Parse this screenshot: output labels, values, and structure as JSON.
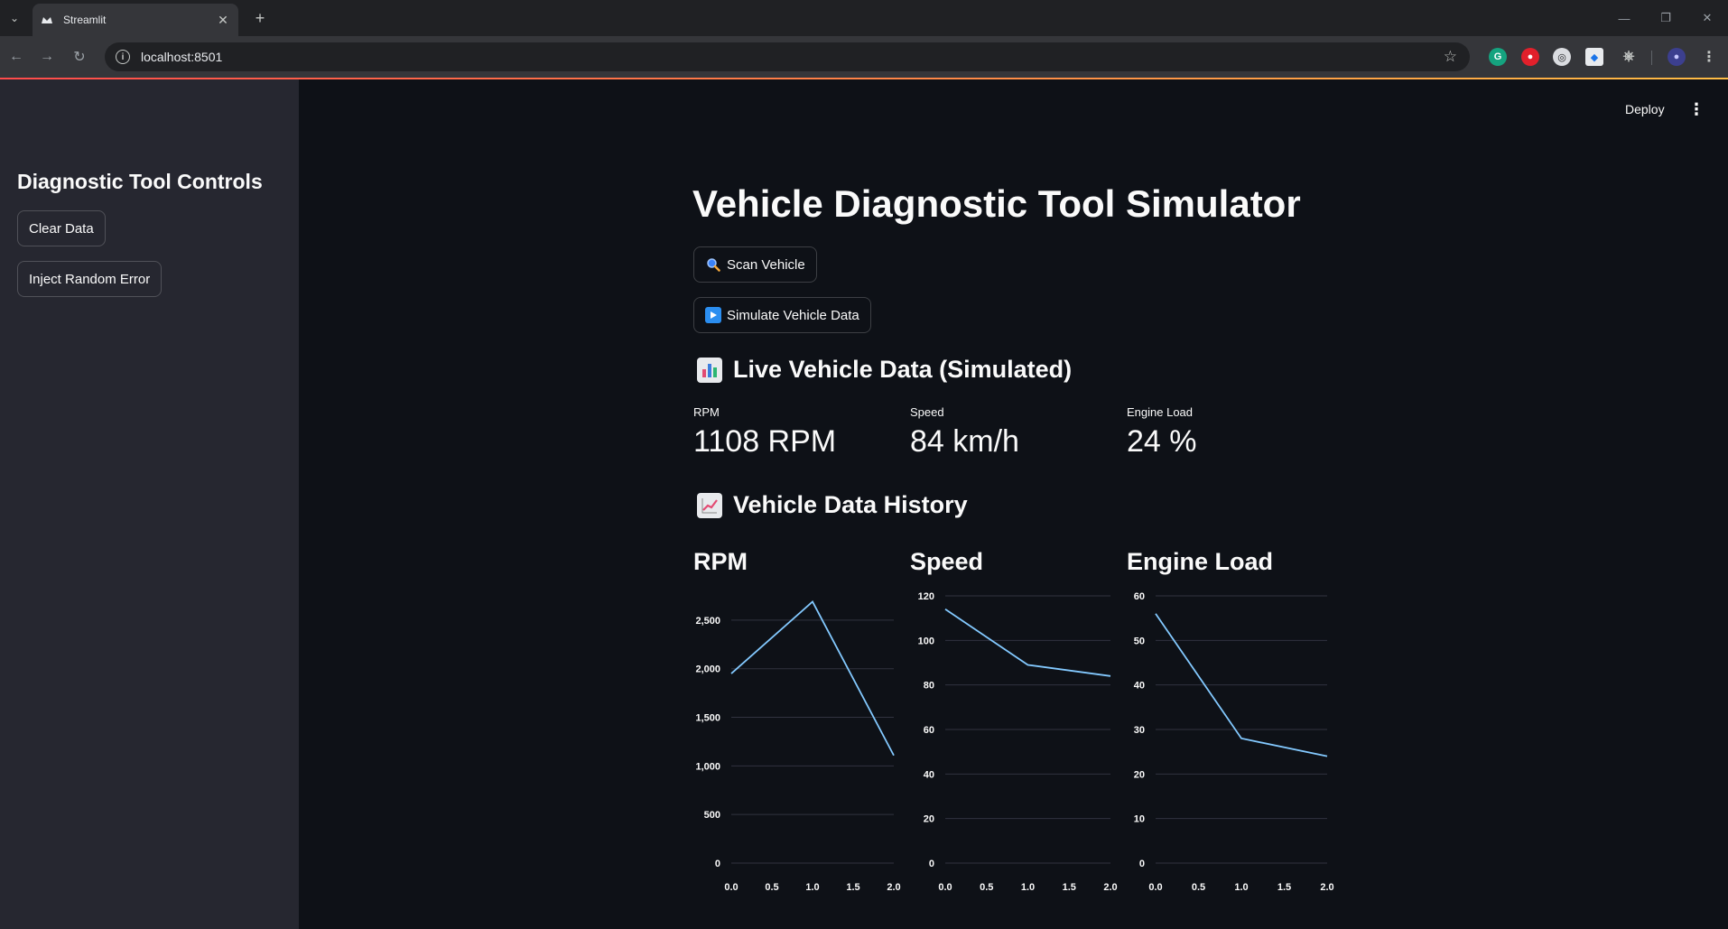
{
  "browser": {
    "tab_title": "Streamlit",
    "url": "localhost:8501"
  },
  "header": {
    "deploy_label": "Deploy"
  },
  "sidebar": {
    "title": "Diagnostic Tool Controls",
    "buttons": [
      "Clear Data",
      "Inject Random Error"
    ]
  },
  "main": {
    "title": "Vehicle Diagnostic Tool Simulator",
    "buttons": [
      {
        "icon": "magnifier-icon",
        "label": "Scan Vehicle"
      },
      {
        "icon": "play-icon",
        "label": "Simulate Vehicle Data"
      }
    ],
    "live_header": "Live Vehicle Data (Simulated)",
    "metrics": [
      {
        "label": "RPM",
        "value": "1108 RPM"
      },
      {
        "label": "Speed",
        "value": "84 km/h"
      },
      {
        "label": "Engine Load",
        "value": "24 %"
      }
    ],
    "history_header": "Vehicle Data History"
  },
  "colors": {
    "line": "#83c9ff",
    "accent": "#ff4b4b"
  },
  "chart_data": [
    {
      "type": "line",
      "title": "RPM",
      "x": [
        0,
        1,
        2
      ],
      "series": [
        {
          "values": [
            1950,
            2690,
            1108
          ]
        }
      ],
      "xticks": [
        "0.0",
        "0.5",
        "1.0",
        "1.5",
        "2.0"
      ],
      "yticks": [
        "0",
        "500",
        "1,000",
        "1,500",
        "2,000",
        "2,500"
      ],
      "xlim": [
        0,
        2
      ],
      "ylim": [
        0,
        2750
      ],
      "grid": true
    },
    {
      "type": "line",
      "title": "Speed",
      "x": [
        0,
        1,
        2
      ],
      "series": [
        {
          "values": [
            114,
            89,
            84
          ]
        }
      ],
      "xticks": [
        "0.0",
        "0.5",
        "1.0",
        "1.5",
        "2.0"
      ],
      "yticks": [
        "0",
        "20",
        "40",
        "60",
        "80",
        "100",
        "120"
      ],
      "xlim": [
        0,
        2
      ],
      "ylim": [
        0,
        120
      ],
      "grid": true
    },
    {
      "type": "line",
      "title": "Engine Load",
      "x": [
        0,
        1,
        2
      ],
      "series": [
        {
          "values": [
            56,
            28,
            24
          ]
        }
      ],
      "xticks": [
        "0.0",
        "0.5",
        "1.0",
        "1.5",
        "2.0"
      ],
      "yticks": [
        "0",
        "10",
        "20",
        "30",
        "40",
        "50",
        "60"
      ],
      "xlim": [
        0,
        2
      ],
      "ylim": [
        0,
        60
      ],
      "grid": true
    }
  ]
}
